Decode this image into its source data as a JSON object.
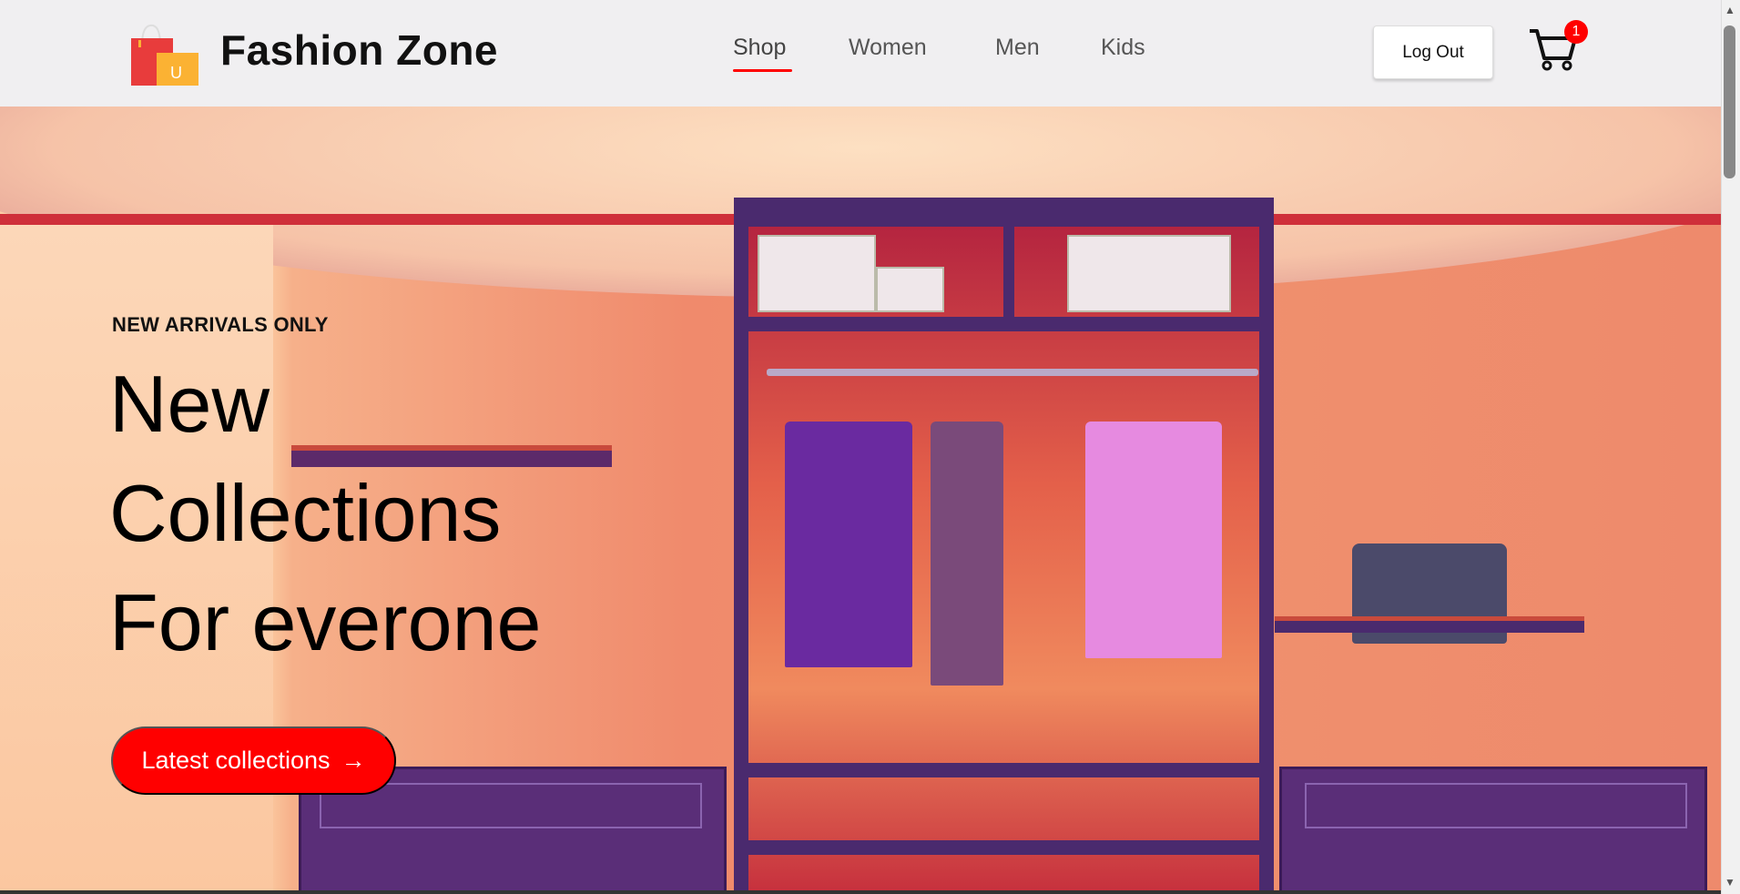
{
  "header": {
    "brand": "Fashion Zone",
    "logo_letter": "U",
    "nav": [
      {
        "label": "Shop",
        "active": true
      },
      {
        "label": "Women",
        "active": false
      },
      {
        "label": "Men",
        "active": false
      },
      {
        "label": "Kids",
        "active": false
      }
    ],
    "logout_label": "Log Out",
    "cart_count": "1"
  },
  "hero": {
    "eyebrow": "NEW ARRIVALS ONLY",
    "headline_lines": [
      "New",
      "Collections",
      "For everone"
    ],
    "cta_label": "Latest collections",
    "cta_arrow": "→"
  },
  "colors": {
    "accent": "#ff0000",
    "header_bg": "#f0eff1"
  }
}
